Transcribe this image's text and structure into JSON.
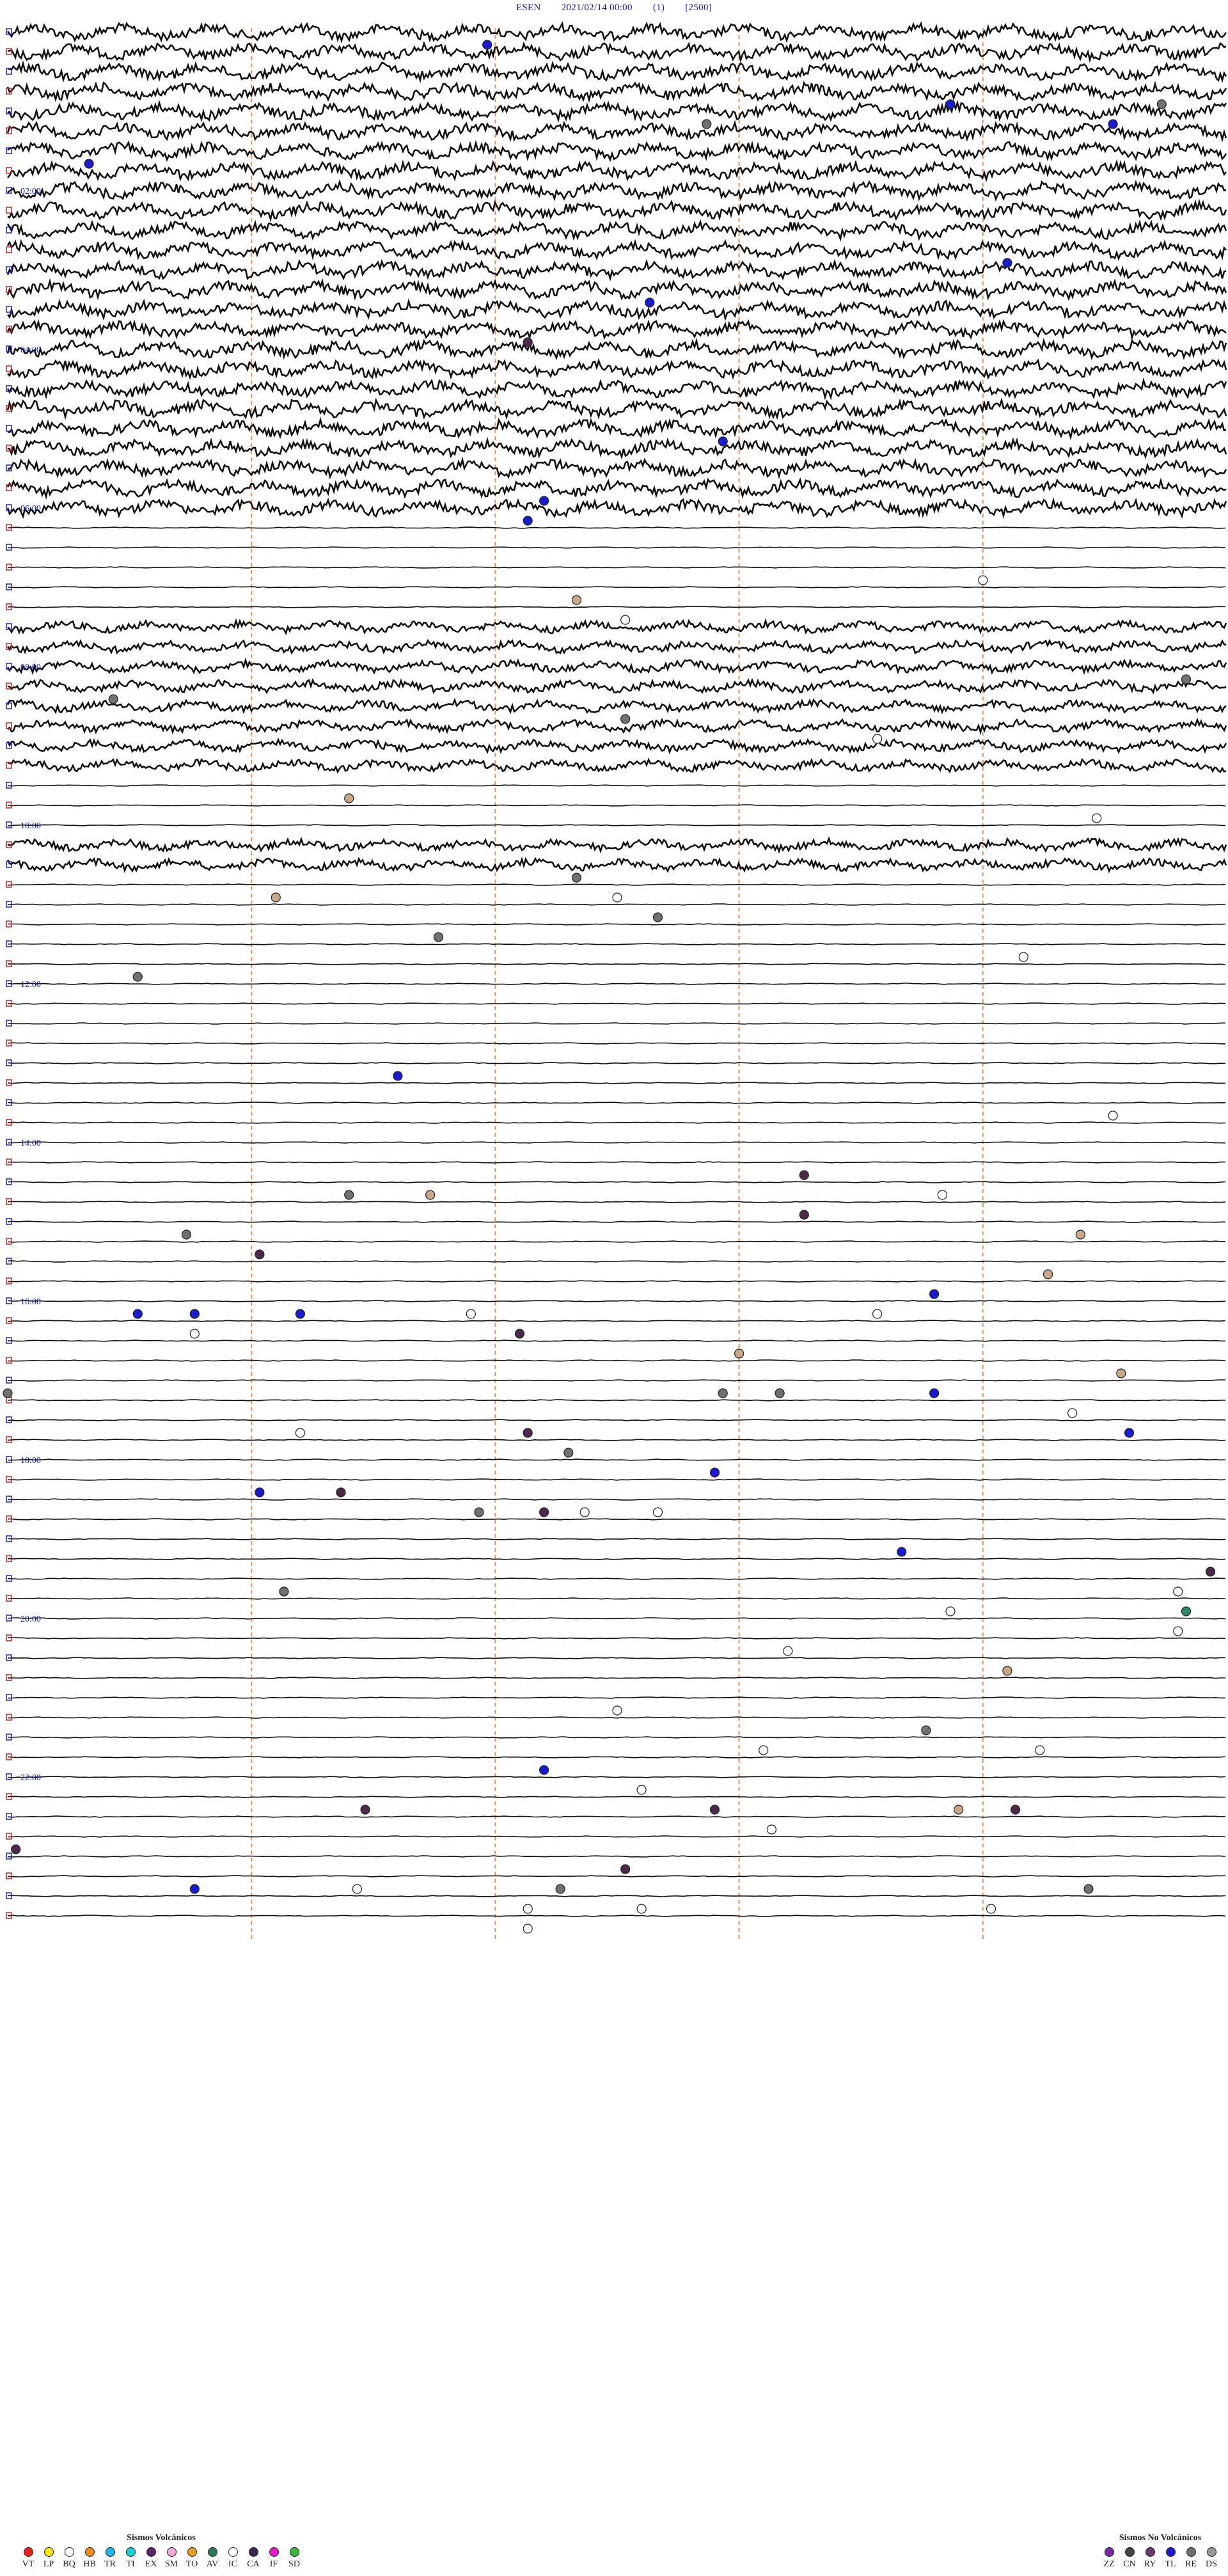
{
  "header": {
    "station": "ESEN",
    "datetime": "2021/02/14 00:00",
    "code1": "(1)",
    "code2": "[2500]"
  },
  "time_labels": [
    "02:00",
    "04:00",
    "06:00",
    "08:00",
    "10:00",
    "12:00",
    "14:00",
    "16:00",
    "18:00",
    "20:00",
    "22:00"
  ],
  "legend_volcanic": {
    "title": "Sismos Volcánicos",
    "items": [
      {
        "code": "VT",
        "color": "#e8231e"
      },
      {
        "code": "LP",
        "color": "#f4e61a"
      },
      {
        "code": "BQ",
        "color": "#ffffff"
      },
      {
        "code": "HB",
        "color": "#f08a1c"
      },
      {
        "code": "TR",
        "color": "#1fb8e8"
      },
      {
        "code": "TI",
        "color": "#1ad0d8"
      },
      {
        "code": "EX",
        "color": "#5a2468"
      },
      {
        "code": "SM",
        "color": "#f0a8d8"
      },
      {
        "code": "TO",
        "color": "#e8a020"
      },
      {
        "code": "AV",
        "color": "#2a7a5a"
      },
      {
        "code": "IC",
        "color": "#ffffff"
      },
      {
        "code": "CA",
        "color": "#3a2844"
      },
      {
        "code": "IF",
        "color": "#e81ad0"
      },
      {
        "code": "SD",
        "color": "#3ab83a"
      }
    ]
  },
  "legend_nonvolcanic": {
    "title": "Sismos No Volcánicos",
    "items": [
      {
        "code": "ZZ",
        "color": "#7a2aa8"
      },
      {
        "code": "CN",
        "color": "#444444"
      },
      {
        "code": "RY",
        "color": "#6a3a6a"
      },
      {
        "code": "TL",
        "color": "#1a1ad0"
      },
      {
        "code": "RE",
        "color": "#707070"
      },
      {
        "code": "DS",
        "color": "#9a9a9a"
      }
    ]
  },
  "chart_data": {
    "type": "helicorder",
    "rows": 96,
    "minutes_per_row": 15,
    "noisy_row_ranges": [
      [
        0,
        24
      ],
      [
        30,
        31
      ],
      [
        32,
        37
      ],
      [
        41,
        42
      ]
    ],
    "event_colors": {
      "TL": "#1a1ad0",
      "RE": "#707070",
      "IC": "#ffffff",
      "CA": "#4a2a48",
      "HB": "#c8a88a",
      "AV": "#2a8a6a"
    },
    "events": [
      {
        "row": 0,
        "min": 5.9,
        "type": "TL"
      },
      {
        "row": 1,
        "min": 16.3,
        "type": "TL"
      },
      {
        "row": 3,
        "min": 11.6,
        "type": "TL"
      },
      {
        "row": 3,
        "min": 14.2,
        "type": "RE"
      },
      {
        "row": 4,
        "min": 13.6,
        "type": "TL"
      },
      {
        "row": 4,
        "min": 8.6,
        "type": "RE"
      },
      {
        "row": 6,
        "min": 1.0,
        "type": "TL"
      },
      {
        "row": 11,
        "min": 12.3,
        "type": "TL"
      },
      {
        "row": 13,
        "min": 7.9,
        "type": "TL"
      },
      {
        "row": 15,
        "min": 6.4,
        "type": "CA"
      },
      {
        "row": 20,
        "min": 8.8,
        "type": "TL"
      },
      {
        "row": 23,
        "min": 6.6,
        "type": "TL"
      },
      {
        "row": 24,
        "min": 6.4,
        "type": "TL"
      },
      {
        "row": 27,
        "min": 12.0,
        "type": "IC"
      },
      {
        "row": 28,
        "min": 7.0,
        "type": "HB"
      },
      {
        "row": 29,
        "min": 7.6,
        "type": "IC"
      },
      {
        "row": 32,
        "min": 14.5,
        "type": "RE"
      },
      {
        "row": 33,
        "min": 1.3,
        "type": "RE"
      },
      {
        "row": 34,
        "min": 7.6,
        "type": "RE"
      },
      {
        "row": 35,
        "min": 10.7,
        "type": "IC"
      },
      {
        "row": 38,
        "min": 4.2,
        "type": "HB"
      },
      {
        "row": 39,
        "min": 13.4,
        "type": "IC"
      },
      {
        "row": 42,
        "min": 7.0,
        "type": "RE"
      },
      {
        "row": 43,
        "min": 3.3,
        "type": "HB"
      },
      {
        "row": 43,
        "min": 7.5,
        "type": "IC"
      },
      {
        "row": 44,
        "min": 8.0,
        "type": "RE"
      },
      {
        "row": 45,
        "min": 5.3,
        "type": "RE"
      },
      {
        "row": 46,
        "min": 12.5,
        "type": "IC"
      },
      {
        "row": 47,
        "min": 1.6,
        "type": "RE"
      },
      {
        "row": 52,
        "min": 4.8,
        "type": "TL"
      },
      {
        "row": 54,
        "min": 13.6,
        "type": "IC"
      },
      {
        "row": 57,
        "min": 9.8,
        "type": "CA"
      },
      {
        "row": 58,
        "min": 4.2,
        "type": "RE"
      },
      {
        "row": 58,
        "min": 5.2,
        "type": "HB"
      },
      {
        "row": 58,
        "min": 11.5,
        "type": "IC"
      },
      {
        "row": 59,
        "min": 9.8,
        "type": "CA"
      },
      {
        "row": 60,
        "min": 2.2,
        "type": "RE"
      },
      {
        "row": 60,
        "min": 13.2,
        "type": "HB"
      },
      {
        "row": 61,
        "min": 3.1,
        "type": "CA"
      },
      {
        "row": 62,
        "min": 12.8,
        "type": "HB"
      },
      {
        "row": 63,
        "min": 11.4,
        "type": "TL"
      },
      {
        "row": 64,
        "min": 1.6,
        "type": "TL"
      },
      {
        "row": 64,
        "min": 2.3,
        "type": "TL"
      },
      {
        "row": 64,
        "min": 3.6,
        "type": "TL"
      },
      {
        "row": 64,
        "min": 5.7,
        "type": "IC"
      },
      {
        "row": 64,
        "min": 10.7,
        "type": "IC"
      },
      {
        "row": 65,
        "min": 2.3,
        "type": "IC"
      },
      {
        "row": 65,
        "min": 6.3,
        "type": "CA"
      },
      {
        "row": 66,
        "min": 9.0,
        "type": "HB"
      },
      {
        "row": 67,
        "min": 13.7,
        "type": "HB"
      },
      {
        "row": 68,
        "min": 0.0,
        "type": "RE"
      },
      {
        "row": 68,
        "min": 8.8,
        "type": "RE"
      },
      {
        "row": 68,
        "min": 9.5,
        "type": "RE"
      },
      {
        "row": 68,
        "min": 11.4,
        "type": "TL"
      },
      {
        "row": 69,
        "min": 13.1,
        "type": "IC"
      },
      {
        "row": 70,
        "min": 3.6,
        "type": "IC"
      },
      {
        "row": 70,
        "min": 6.4,
        "type": "CA"
      },
      {
        "row": 70,
        "min": 13.8,
        "type": "TL"
      },
      {
        "row": 71,
        "min": 6.9,
        "type": "RE"
      },
      {
        "row": 72,
        "min": 8.7,
        "type": "TL"
      },
      {
        "row": 73,
        "min": 3.1,
        "type": "TL"
      },
      {
        "row": 73,
        "min": 4.1,
        "type": "CA"
      },
      {
        "row": 74,
        "min": 5.8,
        "type": "RE"
      },
      {
        "row": 74,
        "min": 6.6,
        "type": "CA"
      },
      {
        "row": 74,
        "min": 7.1,
        "type": "IC"
      },
      {
        "row": 74,
        "min": 8.0,
        "type": "IC"
      },
      {
        "row": 76,
        "min": 11.0,
        "type": "TL"
      },
      {
        "row": 77,
        "min": 14.8,
        "type": "CA"
      },
      {
        "row": 78,
        "min": 3.4,
        "type": "RE"
      },
      {
        "row": 78,
        "min": 14.4,
        "type": "IC"
      },
      {
        "row": 79,
        "min": 11.6,
        "type": "IC"
      },
      {
        "row": 79,
        "min": 14.5,
        "type": "AV"
      },
      {
        "row": 80,
        "min": 14.4,
        "type": "IC"
      },
      {
        "row": 81,
        "min": 9.6,
        "type": "IC"
      },
      {
        "row": 82,
        "min": 12.3,
        "type": "HB"
      },
      {
        "row": 84,
        "min": 7.5,
        "type": "IC"
      },
      {
        "row": 85,
        "min": 11.3,
        "type": "RE"
      },
      {
        "row": 86,
        "min": 9.3,
        "type": "IC"
      },
      {
        "row": 86,
        "min": 12.7,
        "type": "IC"
      },
      {
        "row": 87,
        "min": 6.6,
        "type": "TL"
      },
      {
        "row": 88,
        "min": 7.8,
        "type": "IC"
      },
      {
        "row": 89,
        "min": 4.4,
        "type": "CA"
      },
      {
        "row": 89,
        "min": 8.7,
        "type": "CA"
      },
      {
        "row": 89,
        "min": 11.7,
        "type": "HB"
      },
      {
        "row": 89,
        "min": 12.4,
        "type": "CA"
      },
      {
        "row": 90,
        "min": 9.4,
        "type": "IC"
      },
      {
        "row": 91,
        "min": 0.1,
        "type": "CA"
      },
      {
        "row": 92,
        "min": 7.6,
        "type": "CA"
      },
      {
        "row": 93,
        "min": 2.3,
        "type": "TL"
      },
      {
        "row": 93,
        "min": 4.3,
        "type": "IC"
      },
      {
        "row": 93,
        "min": 6.8,
        "type": "RE"
      },
      {
        "row": 93,
        "min": 13.3,
        "type": "RE"
      },
      {
        "row": 94,
        "min": 6.4,
        "type": "IC"
      },
      {
        "row": 94,
        "min": 7.8,
        "type": "IC"
      },
      {
        "row": 94,
        "min": 12.1,
        "type": "IC"
      },
      {
        "row": 95,
        "min": 6.4,
        "type": "IC"
      }
    ]
  }
}
